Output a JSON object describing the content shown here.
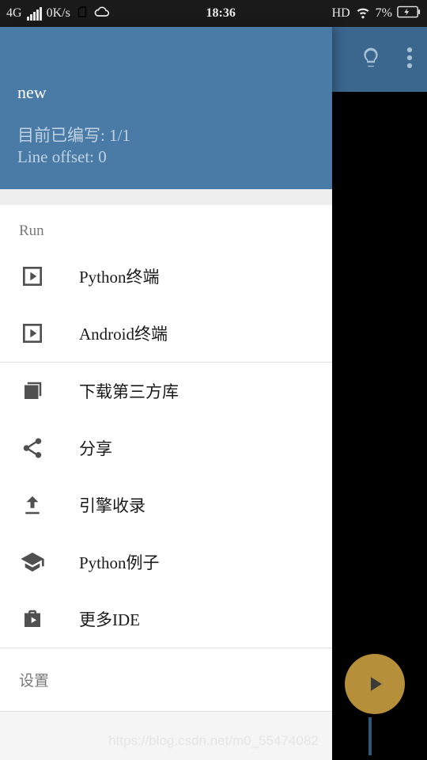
{
  "status": {
    "network": "4G",
    "speed": "0K/s",
    "time": "18:36",
    "hd": "HD",
    "battery": "7%"
  },
  "drawer": {
    "file": "new",
    "edited": "目前已编写: 1/1",
    "offset": "Line offset: 0",
    "run_title": "Run",
    "items_run": [
      {
        "label": "Python终端",
        "icon": "play-box"
      },
      {
        "label": "Android终端",
        "icon": "play-box"
      }
    ],
    "items_main": [
      {
        "label": "下载第三方库",
        "icon": "library"
      },
      {
        "label": "分享",
        "icon": "share"
      },
      {
        "label": "引擎收录",
        "icon": "upload"
      },
      {
        "label": "Python例子",
        "icon": "school"
      },
      {
        "label": "更多IDE",
        "icon": "briefcase-play"
      }
    ],
    "settings": "设置"
  },
  "watermark": "https://blog.csdn.net/m0_55474082"
}
